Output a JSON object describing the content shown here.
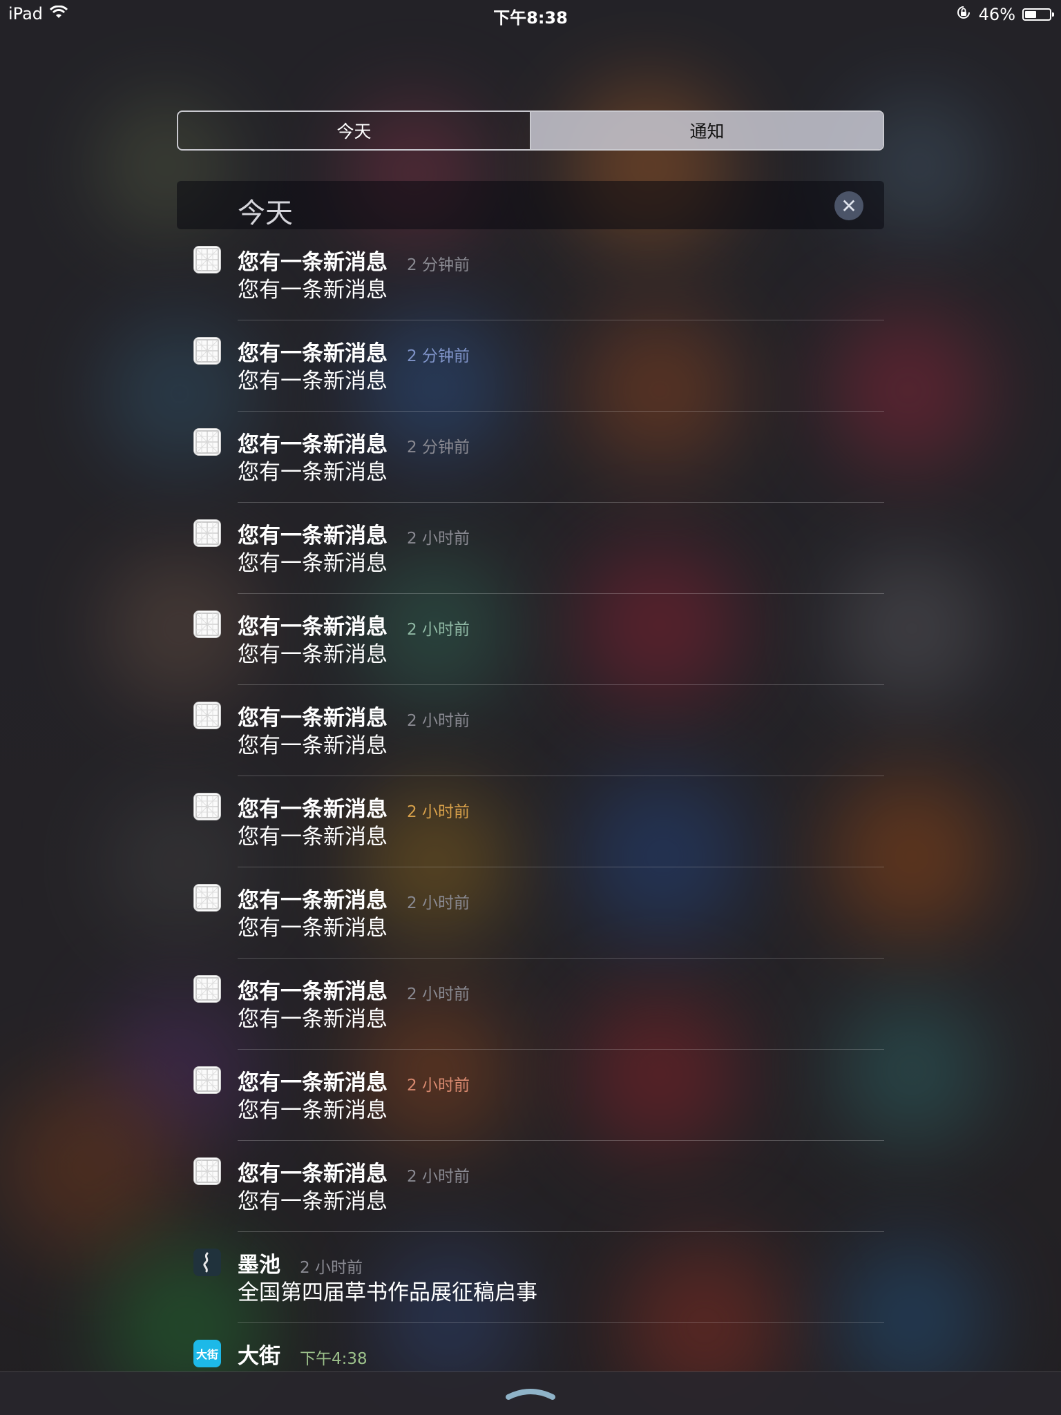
{
  "status_bar": {
    "device": "iPad",
    "time": "下午8:38",
    "battery": "46%",
    "battery_level": 0.46
  },
  "tabs": [
    {
      "label": "今天",
      "selected": false
    },
    {
      "label": "通知",
      "selected": true
    }
  ],
  "section": {
    "title": "今天",
    "clear_icon": "close-icon"
  },
  "notifications": [
    {
      "app_icon": "grid-app-icon",
      "title": "您有一条新消息",
      "time": "2 分钟前",
      "body": "您有一条新消息",
      "time_color": "#8a8a92"
    },
    {
      "app_icon": "grid-app-icon",
      "title": "您有一条新消息",
      "time": "2 分钟前",
      "body": "您有一条新消息",
      "time_color": "#7f93c8"
    },
    {
      "app_icon": "grid-app-icon",
      "title": "您有一条新消息",
      "time": "2 分钟前",
      "body": "您有一条新消息",
      "time_color": "#8a8a92"
    },
    {
      "app_icon": "grid-app-icon",
      "title": "您有一条新消息",
      "time": "2 小时前",
      "body": "您有一条新消息",
      "time_color": "#8a8a92"
    },
    {
      "app_icon": "grid-app-icon",
      "title": "您有一条新消息",
      "time": "2 小时前",
      "body": "您有一条新消息",
      "time_color": "#8fb8a4"
    },
    {
      "app_icon": "grid-app-icon",
      "title": "您有一条新消息",
      "time": "2 小时前",
      "body": "您有一条新消息",
      "time_color": "#8a8a92"
    },
    {
      "app_icon": "grid-app-icon",
      "title": "您有一条新消息",
      "time": "2 小时前",
      "body": "您有一条新消息",
      "time_color": "#d7a04a"
    },
    {
      "app_icon": "grid-app-icon",
      "title": "您有一条新消息",
      "time": "2 小时前",
      "body": "您有一条新消息",
      "time_color": "#8a8a92"
    },
    {
      "app_icon": "grid-app-icon",
      "title": "您有一条新消息",
      "time": "2 小时前",
      "body": "您有一条新消息",
      "time_color": "#8a8a92"
    },
    {
      "app_icon": "grid-app-icon",
      "title": "您有一条新消息",
      "time": "2 小时前",
      "body": "您有一条新消息",
      "time_color": "#d98a70"
    },
    {
      "app_icon": "grid-app-icon",
      "title": "您有一条新消息",
      "time": "2 小时前",
      "body": "您有一条新消息",
      "time_color": "#8a8a92"
    },
    {
      "app_icon": "mochi-app-icon",
      "title": "墨池",
      "time": "2 小时前",
      "body": "全国第四届草书作品展征稿启事",
      "time_color": "#8a8a92"
    },
    {
      "app_icon": "dajie-app-icon",
      "icon_text": "大街",
      "title": "大街",
      "time": "下午4:38",
      "body": "",
      "time_color": "#9bc08a"
    }
  ],
  "bottom": {
    "handle_icon": "chevron-up-handle-icon"
  }
}
